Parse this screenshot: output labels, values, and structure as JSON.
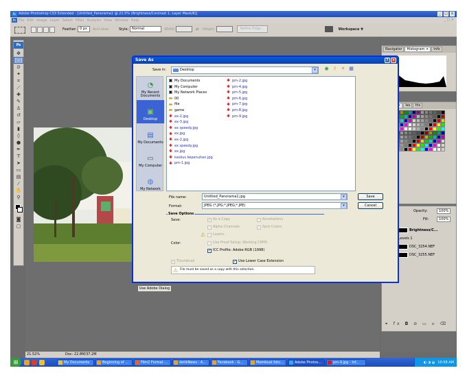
{
  "window": {
    "title": "Adobe Photoshop CS3 Extended - [Untitled_Panorama1 @ 21.5% (Brightness/Contrast 1, Layer Mask/8)]"
  },
  "menu": [
    "File",
    "Edit",
    "Image",
    "Layer",
    "Select",
    "Filter",
    "Analysis",
    "View",
    "Window",
    "Help"
  ],
  "options": {
    "feather_label": "Feather:",
    "feather_value": "0 px",
    "antialias": "Anti-alias",
    "style_label": "Style:",
    "style_value": "Normal",
    "width_label": "Width:",
    "height_label": "Height:",
    "refine_edge": "Refine Edge...",
    "workspace": "Workspace ▼"
  },
  "status": {
    "zoom": "21.52%",
    "doc": "Doc: 22.8M/37.2M"
  },
  "panels": {
    "histogram_tabs": [
      "Navigator",
      "Histogram ×",
      "Info"
    ],
    "swatches_tabs": [
      "atches ×",
      "les",
      "ths"
    ],
    "layers": {
      "opacity_label": "Opacity:",
      "opacity_value": "100%",
      "fill_label": "Fill:",
      "fill_value": "100%",
      "rows": [
        "Brightness/C...",
        "Levels 1",
        "DSC_3254.NEF",
        "DSC_3255.NEF"
      ]
    }
  },
  "dialog": {
    "title": "Save As",
    "save_in_label": "Save in:",
    "save_in_value": "Desktop",
    "places": [
      "My Recent Documents",
      "Desktop",
      "My Documents",
      "My Computer",
      "My Network"
    ],
    "files_col1": [
      {
        "name": "My Documents",
        "kind": "sys"
      },
      {
        "name": "My Computer",
        "kind": "sys"
      },
      {
        "name": "My Network Places",
        "kind": "sys"
      },
      {
        "name": "00",
        "kind": "fold"
      },
      {
        "name": "file",
        "kind": "fold"
      },
      {
        "name": "game",
        "kind": "fold"
      },
      {
        "name": "ex-2.jpg",
        "kind": "img"
      },
      {
        "name": "ex-3.jpg",
        "kind": "img"
      },
      {
        "name": "ex speedy.jpg",
        "kind": "img"
      },
      {
        "name": "ex.jpg",
        "kind": "img"
      },
      {
        "name": "ex-2.jpg",
        "kind": "img"
      },
      {
        "name": "ex speedy.jpg",
        "kind": "img"
      },
      {
        "name": "ex.jpg",
        "kind": "img"
      },
      {
        "name": "kaskus kepenuhan.jpg",
        "kind": "img"
      },
      {
        "name": "pm-1.jpg",
        "kind": "img"
      }
    ],
    "files_col2": [
      {
        "name": "pm-2.jpg",
        "kind": "img"
      },
      {
        "name": "pm-4.jpg",
        "kind": "img"
      },
      {
        "name": "pm-5.jpg",
        "kind": "img"
      },
      {
        "name": "pm-6.jpg",
        "kind": "img"
      },
      {
        "name": "pm-7.jpg",
        "kind": "img"
      },
      {
        "name": "pm-8.jpg",
        "kind": "img"
      },
      {
        "name": "pm-9.jpg",
        "kind": "img"
      }
    ],
    "file_name_label": "File name:",
    "file_name_value": "Untitled_Panorama1.jpg",
    "format_label": "Format:",
    "format_value": "JPEG (*.JPG;*.JPEG;*.JPE)",
    "save_button": "Save",
    "cancel_button": "Cancel",
    "save_options_title": "Save Options",
    "save_label": "Save:",
    "as_a_copy": "As a Copy",
    "annotations": "Annotations",
    "alpha_channels": "Alpha Channels",
    "spot_colors": "Spot Colors",
    "layers": "Layers",
    "color_label": "Color:",
    "use_proof_setup": "Use Proof Setup:  Working CMYK",
    "icc_profile": "ICC Profile:  Adobe RGB (1998)",
    "thumbnail": "Thumbnail",
    "lower_case_ext": "Use Lower Case Extension",
    "warning": "File must be saved as a copy with this selection.",
    "adobe_dialog_button": "Use Adobe Dialog"
  },
  "taskbar": {
    "tasks": [
      "My Documents",
      "Beginning of ...",
      "Film2 Format ...",
      "detikNews : A...",
      "Facebook - G...",
      "Membuat foto...",
      "Adobe Photos...",
      "pm-9.jpg - Inf..."
    ],
    "clock": "10:58 AM"
  },
  "colors": {
    "accent": "#0831d9",
    "taskbar": "#245edb",
    "title_red": "#d02020"
  }
}
